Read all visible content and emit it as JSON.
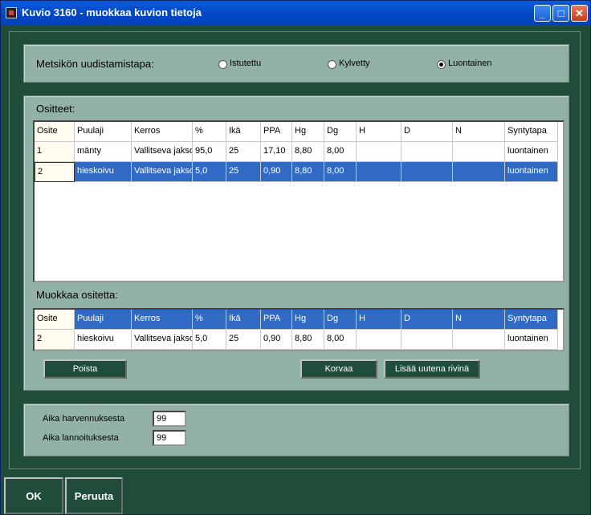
{
  "window": {
    "title": "Kuvio 3160 - muokkaa kuvion tietoja",
    "minimize": "_",
    "maximize": "□",
    "close": "✕"
  },
  "regeneration": {
    "label": "Metsikön uudistamistapa:",
    "options": [
      {
        "label": "Istutettu",
        "selected": false
      },
      {
        "label": "Kylvetty",
        "selected": false
      },
      {
        "label": "Luontainen",
        "selected": true
      }
    ]
  },
  "strata": {
    "label": "Ositteet:",
    "columns": [
      "Osite",
      "Puulaji",
      "Kerros",
      "%",
      "Ikä",
      "PPA",
      "Hg",
      "Dg",
      "H",
      "D",
      "N",
      "Syntytapa"
    ],
    "rows": [
      [
        "1",
        "mänty",
        "Vallitseva jakso",
        "95,0",
        "25",
        "17,10",
        "8,80",
        "8,00",
        "",
        "",
        "",
        "luontainen"
      ],
      [
        "2",
        "hieskoivu",
        "Vallitseva jakso",
        "5,0",
        "25",
        "0,90",
        "8,80",
        "8,00",
        "",
        "",
        "",
        "luontainen"
      ]
    ],
    "selected_row": 1
  },
  "edit": {
    "label": "Muokkaa ositetta:",
    "columns": [
      "Osite",
      "Puulaji",
      "Kerros",
      "%",
      "Ikä",
      "PPA",
      "Hg",
      "Dg",
      "H",
      "D",
      "N",
      "Syntytapa"
    ],
    "row": [
      "2",
      "hieskoivu",
      "Vallitseva jakso",
      "5,0",
      "25",
      "0,90",
      "8,80",
      "8,00",
      "",
      "",
      "",
      "luontainen"
    ]
  },
  "buttons": {
    "delete": "Poista",
    "replace": "Korvaa",
    "add_new": "Lisää uutena rivinä",
    "ok": "OK",
    "cancel": "Peruuta"
  },
  "times": {
    "thinning_label": "Aika harvennuksesta",
    "thinning_value": "99",
    "fertilization_label": "Aika lannoituksesta",
    "fertilization_value": "99"
  },
  "colors": {
    "background": "#1f4d3a",
    "panel": "#93b2a7",
    "selection": "#316ac5"
  }
}
